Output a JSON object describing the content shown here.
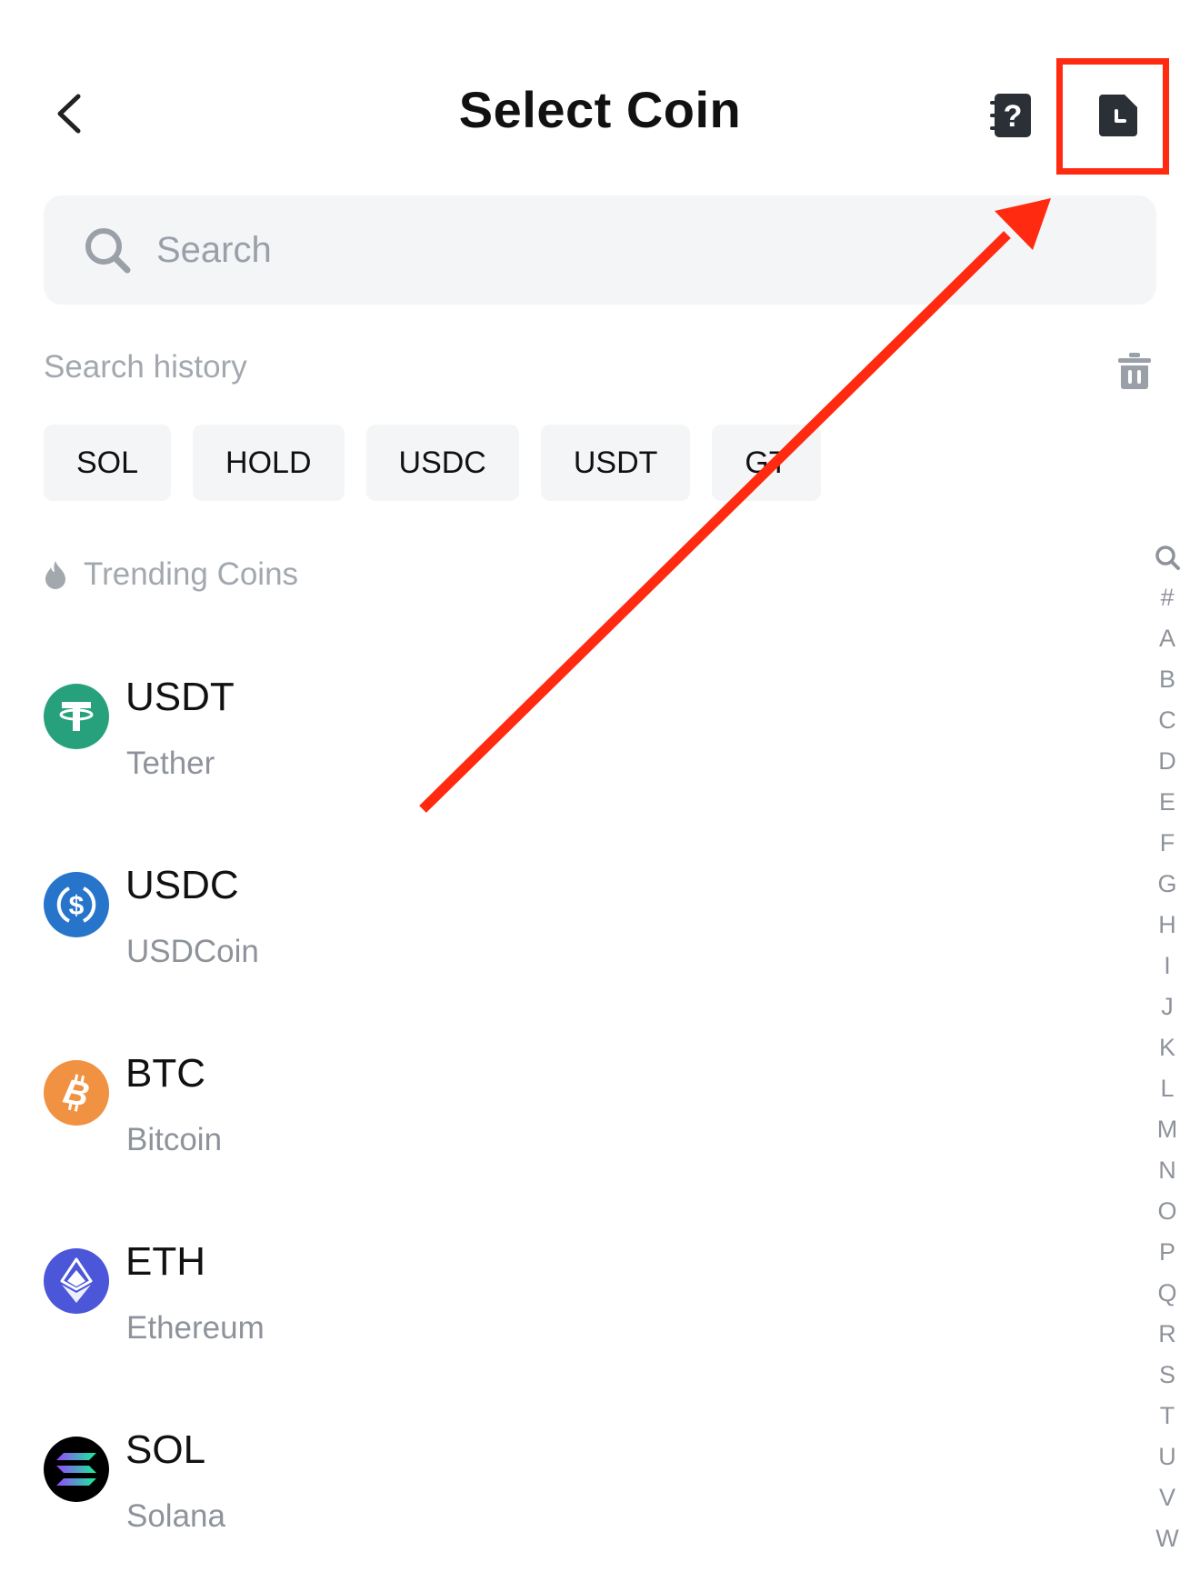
{
  "header": {
    "title": "Select Coin"
  },
  "search": {
    "placeholder": "Search"
  },
  "history": {
    "label": "Search history",
    "chips": [
      "SOL",
      "HOLD",
      "USDC",
      "USDT",
      "GT"
    ]
  },
  "trending": {
    "label": "Trending Coins",
    "coins": [
      {
        "symbol": "USDT",
        "name": "Tether",
        "color": "#26a17b"
      },
      {
        "symbol": "USDC",
        "name": "USDCoin",
        "color": "#2775ca"
      },
      {
        "symbol": "BTC",
        "name": "Bitcoin",
        "color": "#f7931a"
      },
      {
        "symbol": "ETH",
        "name": "Ethereum",
        "color": "#4b56d8"
      },
      {
        "symbol": "SOL",
        "name": "Solana",
        "color": "#000000"
      }
    ]
  },
  "index_bar": {
    "letters": [
      "#",
      "A",
      "B",
      "C",
      "D",
      "E",
      "F",
      "G",
      "H",
      "I",
      "J",
      "K",
      "L",
      "M",
      "N",
      "O",
      "P",
      "Q",
      "R",
      "S",
      "T",
      "U",
      "V",
      "W"
    ]
  },
  "colors": {
    "annotation": "#ff2a10",
    "search_bg": "#f4f5f7",
    "muted_text": "#a3a8af"
  }
}
